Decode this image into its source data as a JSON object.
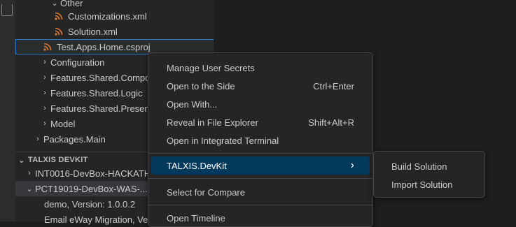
{
  "explorer": {
    "rows": [
      {
        "label": "Other"
      },
      {
        "label": "Customizations.xml"
      },
      {
        "label": "Solution.xml"
      },
      {
        "label": "Test.Apps.Home.csproj"
      },
      {
        "label": "Configuration"
      },
      {
        "label": "Features.Shared.Compos"
      },
      {
        "label": "Features.Shared.Logic"
      },
      {
        "label": "Features.Shared.Presenta"
      },
      {
        "label": "Model"
      },
      {
        "label": "Packages.Main"
      }
    ]
  },
  "devkit": {
    "title": "TALXIS DEVKIT",
    "rows": [
      {
        "label": "INT0016-DevBox-HACKATH"
      },
      {
        "label": "PCT19019-DevBox-WAS-..."
      },
      {
        "label": "demo, Version: 1.0.0.2"
      },
      {
        "label": "Email eWay Migration, Ver"
      }
    ]
  },
  "context_menu": {
    "items": [
      {
        "label": "Manage User Secrets",
        "shortcut": ""
      },
      {
        "label": "Open to the Side",
        "shortcut": "Ctrl+Enter"
      },
      {
        "label": "Open With...",
        "shortcut": ""
      },
      {
        "label": "Reveal in File Explorer",
        "shortcut": "Shift+Alt+R"
      },
      {
        "label": "Open in Integrated Terminal",
        "shortcut": ""
      },
      {
        "label": "TALXIS.DevKit",
        "shortcut": ""
      },
      {
        "label": "Select for Compare",
        "shortcut": ""
      },
      {
        "label": "Open Timeline",
        "shortcut": ""
      }
    ]
  },
  "submenu": {
    "items": [
      {
        "label": "Build Solution"
      },
      {
        "label": "Import Solution"
      }
    ]
  },
  "colors": {
    "rss_icon": "#e37933",
    "menu_highlight": "#04395e",
    "selection_outline": "#2f79c9"
  }
}
